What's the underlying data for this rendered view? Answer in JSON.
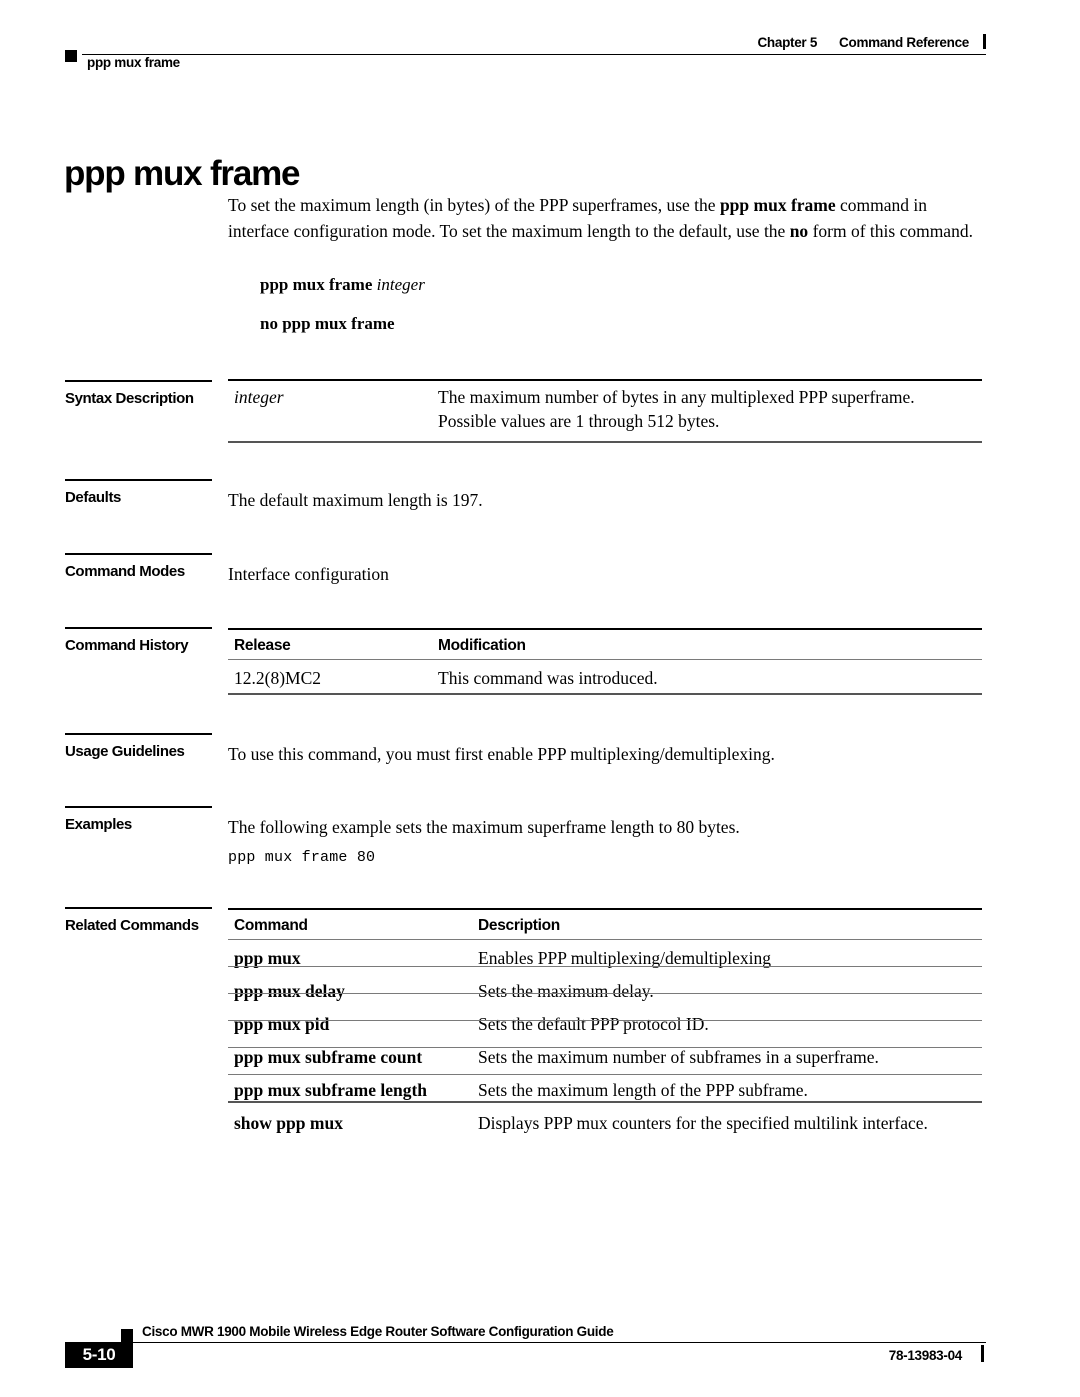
{
  "header": {
    "chapter": "Chapter 5",
    "section": "Command Reference",
    "running_title": "ppp mux frame"
  },
  "page_title": "ppp mux frame",
  "intro": {
    "part1": "To set the maximum length (in bytes) of the PPP superframes, use the ",
    "bold1": "ppp mux frame",
    "part2": " command in interface configuration mode. To set the maximum length to the default, use the ",
    "bold2": "no",
    "part3": " form of this command."
  },
  "syntax": {
    "command": "ppp mux frame",
    "argument": "integer",
    "no_form": "no ppp mux frame"
  },
  "sections": {
    "syntax_description": {
      "label": "Syntax Description",
      "rows": [
        {
          "term": "integer",
          "description": "The maximum number of bytes in any multiplexed PPP superframe. Possible values are 1 through 512 bytes."
        }
      ]
    },
    "defaults": {
      "label": "Defaults",
      "text": "The default maximum length is 197."
    },
    "command_modes": {
      "label": "Command Modes",
      "text": "Interface configuration"
    },
    "command_history": {
      "label": "Command History",
      "headers": [
        "Release",
        "Modification"
      ],
      "rows": [
        [
          "12.2(8)MC2",
          "This command was introduced."
        ]
      ]
    },
    "usage_guidelines": {
      "label": "Usage Guidelines",
      "text": "To use this command, you must first enable PPP multiplexing/demultiplexing."
    },
    "examples": {
      "label": "Examples",
      "text": "The following example sets the maximum superframe length to 80 bytes.",
      "code": "ppp mux frame 80"
    },
    "related_commands": {
      "label": "Related Commands",
      "headers": [
        "Command",
        "Description"
      ],
      "rows": [
        [
          "ppp mux",
          "Enables PPP multiplexing/demultiplexing"
        ],
        [
          "ppp mux delay",
          "Sets the maximum delay."
        ],
        [
          "ppp mux pid",
          "Sets the default PPP protocol ID."
        ],
        [
          "ppp mux subframe count",
          "Sets the maximum number of subframes in a superframe."
        ],
        [
          "ppp mux subframe length",
          "Sets the maximum length of the PPP subframe."
        ],
        [
          "show ppp mux",
          "Displays PPP mux counters for the specified multilink interface."
        ]
      ]
    }
  },
  "footer": {
    "page_number": "5-10",
    "guide_title": "Cisco MWR 1900 Mobile Wireless Edge Router Software Configuration Guide",
    "doc_number": "78-13983-04"
  }
}
